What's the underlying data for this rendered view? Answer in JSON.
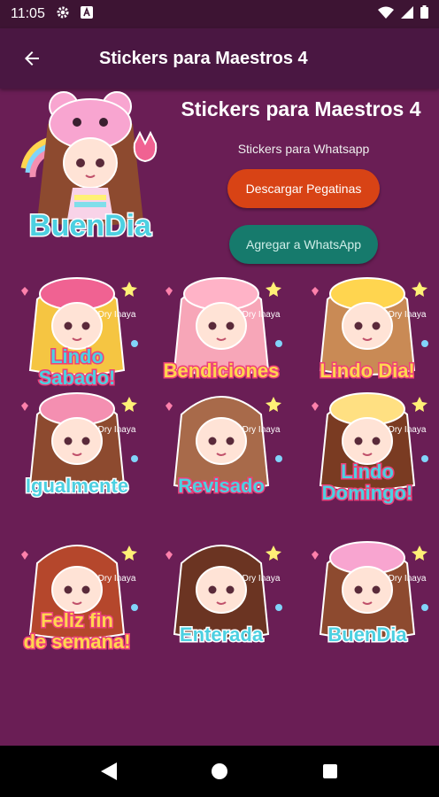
{
  "status_bar": {
    "time": "11:05"
  },
  "app_bar": {
    "title": "Stickers para Maestros 4"
  },
  "pack": {
    "title": "Stickers para Maestros 4",
    "subtitle": "Stickers para Whatsapp",
    "tray_caption": "BuenDia"
  },
  "buttons": {
    "download": "Descargar Pegatinas",
    "add_whatsapp": "Agregar a WhatsApp"
  },
  "stickers": [
    {
      "caption_1": "Lindo",
      "caption_2": "Sabado!",
      "credit": "Dry Inaya"
    },
    {
      "caption_1": "Bendiciones",
      "caption_2": "",
      "credit": "Dry Inaya"
    },
    {
      "caption_1": "Lindo Dia!",
      "caption_2": "",
      "credit": "Dry Inaya"
    },
    {
      "caption_1": "Igualmente",
      "caption_2": "",
      "credit": "Dry Inaya"
    },
    {
      "caption_1": "Revisado",
      "caption_2": "",
      "credit": "Dry Inaya"
    },
    {
      "caption_1": "Lindo",
      "caption_2": "Domingo!",
      "credit": "Dry Inaya"
    },
    {
      "caption_1": "Feliz fin",
      "caption_2": "de semana!",
      "credit": "Dry Inaya"
    },
    {
      "caption_1": "Enterada",
      "caption_2": "",
      "credit": "Dry Inaya"
    },
    {
      "caption_1": "BuenDia",
      "caption_2": "",
      "credit": "Dry Inaya"
    }
  ],
  "colors": {
    "background": "#6a1e55",
    "app_bar": "#4a1742",
    "download_button": "#d84315",
    "whatsapp_button": "#167a6c"
  },
  "icons": {
    "back": "arrow-left-icon",
    "settings": "gear-icon",
    "wifi": "wifi-icon",
    "signal": "signal-icon",
    "battery": "battery-icon"
  }
}
